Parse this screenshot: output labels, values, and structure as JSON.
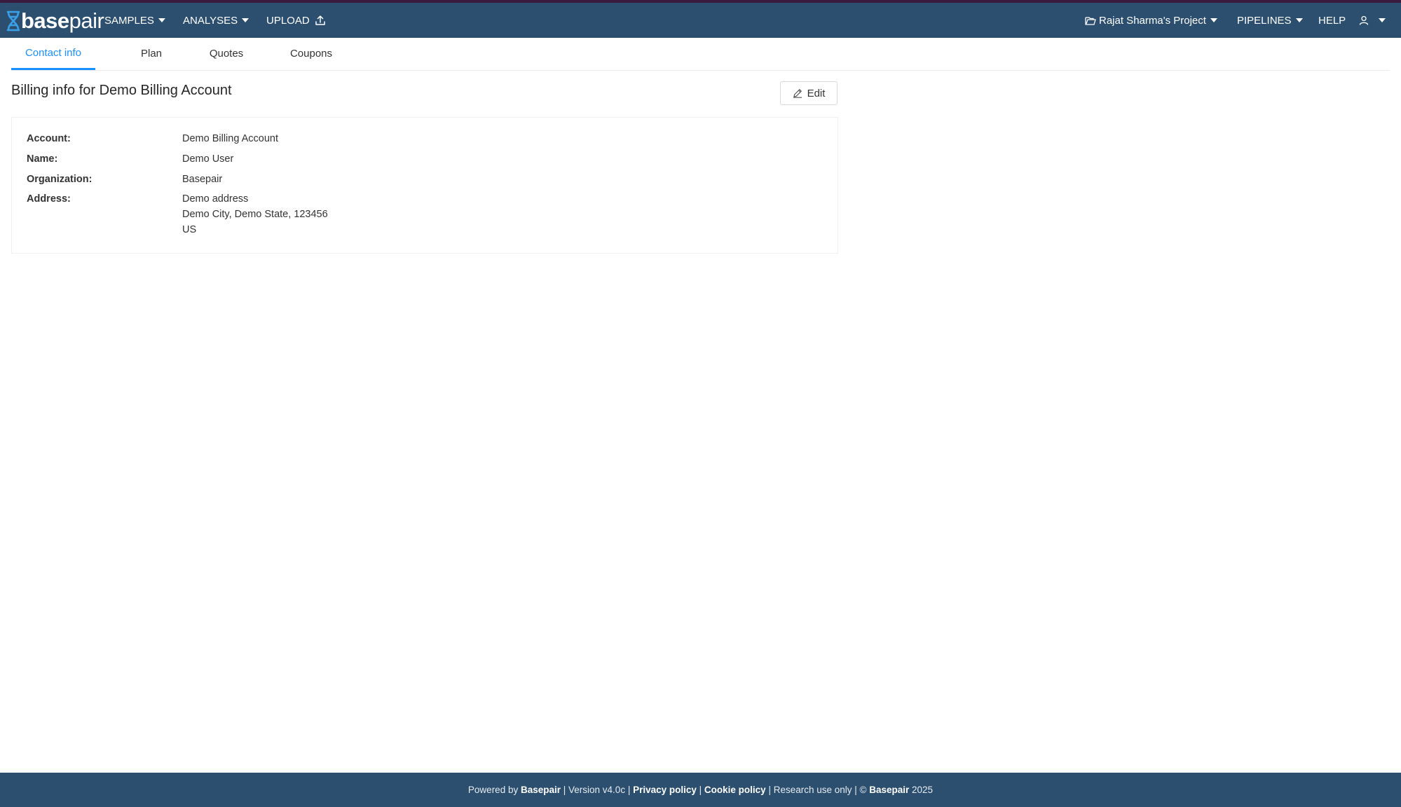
{
  "brand": {
    "logo_base": "base",
    "logo_pair": "pair",
    "accent": "#1890ff",
    "navbar_color": "#2c4f6f"
  },
  "nav": {
    "samples": "SAMPLES",
    "analyses": "ANALYSES",
    "upload": "UPLOAD",
    "project": "Rajat Sharma's Project",
    "pipelines": "PIPELINES",
    "help": "HELP",
    "icons": [
      "dna-logo-icon",
      "upload-icon",
      "folder-icon",
      "user-icon",
      "chevron-down-icon"
    ]
  },
  "tabs": [
    {
      "label": "Contact info",
      "active": true
    },
    {
      "label": "Plan",
      "active": false
    },
    {
      "label": "Quotes",
      "active": false
    },
    {
      "label": "Coupons",
      "active": false
    }
  ],
  "page": {
    "title": "Billing info for Demo Billing Account",
    "edit_label": "Edit"
  },
  "billing": {
    "account_label": "Account:",
    "account": "Demo Billing Account",
    "name_label": "Name:",
    "name": "Demo User",
    "organization_label": "Organization:",
    "organization": "Basepair",
    "address_label": "Address:",
    "address_line1": "Demo address",
    "address_line2": "Demo City, Demo State, 123456",
    "address_line3": "US"
  },
  "footer": {
    "powered_by": "Powered by ",
    "brand": "Basepair",
    "version": " | Version v4.0c | ",
    "privacy": "Privacy policy",
    "sep": " | ",
    "cookie": "Cookie policy",
    "research": " | Research use only | © ",
    "brand2": "Basepair",
    "year": " 2025"
  }
}
